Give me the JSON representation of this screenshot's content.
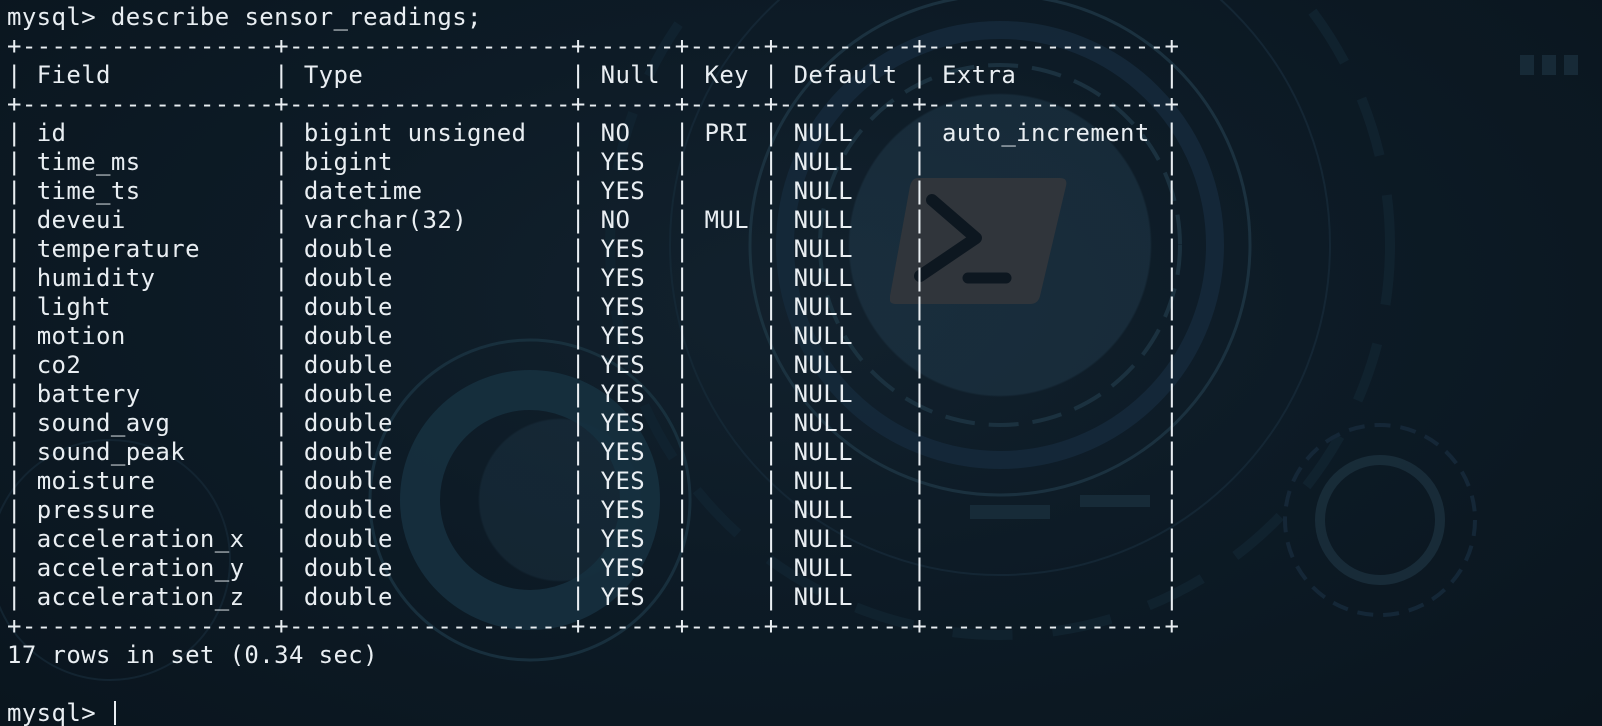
{
  "terminal": {
    "background": "#0b1620",
    "text_color": "#e9eef2",
    "watermark_icon": "powershell-icon",
    "prompt": "mysql>",
    "command": "describe sensor_readings;",
    "border_line": "+-----------------+-------------------+------+-----+---------+----------------+",
    "table": {
      "columns": [
        "Field",
        "Type",
        "Null",
        "Key",
        "Default",
        "Extra"
      ],
      "rows": [
        [
          "id",
          "bigint unsigned",
          "NO",
          "PRI",
          "NULL",
          "auto_increment"
        ],
        [
          "time_ms",
          "bigint",
          "YES",
          "",
          "NULL",
          ""
        ],
        [
          "time_ts",
          "datetime",
          "YES",
          "",
          "NULL",
          ""
        ],
        [
          "deveui",
          "varchar(32)",
          "NO",
          "MUL",
          "NULL",
          ""
        ],
        [
          "temperature",
          "double",
          "YES",
          "",
          "NULL",
          ""
        ],
        [
          "humidity",
          "double",
          "YES",
          "",
          "NULL",
          ""
        ],
        [
          "light",
          "double",
          "YES",
          "",
          "NULL",
          ""
        ],
        [
          "motion",
          "double",
          "YES",
          "",
          "NULL",
          ""
        ],
        [
          "co2",
          "double",
          "YES",
          "",
          "NULL",
          ""
        ],
        [
          "battery",
          "double",
          "YES",
          "",
          "NULL",
          ""
        ],
        [
          "sound_avg",
          "double",
          "YES",
          "",
          "NULL",
          ""
        ],
        [
          "sound_peak",
          "double",
          "YES",
          "",
          "NULL",
          ""
        ],
        [
          "moisture",
          "double",
          "YES",
          "",
          "NULL",
          ""
        ],
        [
          "pressure",
          "double",
          "YES",
          "",
          "NULL",
          ""
        ],
        [
          "acceleration_x",
          "double",
          "YES",
          "",
          "NULL",
          ""
        ],
        [
          "acceleration_y",
          "double",
          "YES",
          "",
          "NULL",
          ""
        ],
        [
          "acceleration_z",
          "double",
          "YES",
          "",
          "NULL",
          ""
        ]
      ]
    },
    "result_summary": "17 rows in set (0.34 sec)"
  }
}
